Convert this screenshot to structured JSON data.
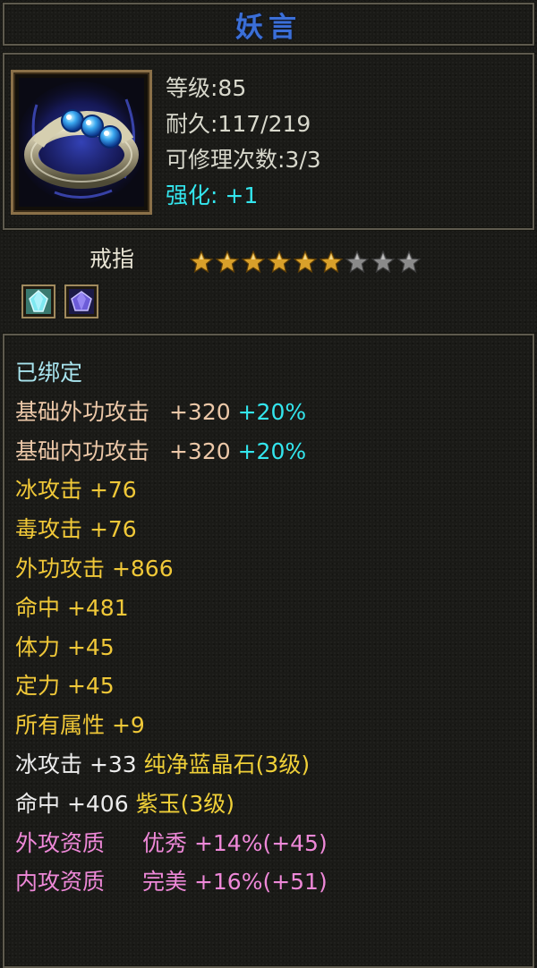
{
  "item": {
    "name": "妖言",
    "level": "等级:85",
    "durability": "耐久:117/219",
    "repair_count": "可修理次数:3/3",
    "enhance": "强化: +1",
    "type": "戒指",
    "stars_filled": 6,
    "stars_total": 9,
    "gem_icons": [
      "blue-crystal-gem-icon",
      "purple-jade-gem-icon"
    ]
  },
  "attributes": {
    "bound": "已绑定",
    "base_outer": {
      "label": "基础外功攻击",
      "value": "+320",
      "bonus": "+20%"
    },
    "base_inner": {
      "label": "基础内功攻击",
      "value": "+320",
      "bonus": "+20%"
    },
    "ice_attack": "冰攻击 +76",
    "poison_attack": "毒攻击 +76",
    "outer_attack": "外功攻击 +866",
    "hit": "命中 +481",
    "stamina": "体力 +45",
    "focus": "定力 +45",
    "all_attrs": "所有属性 +9",
    "gem1": {
      "stat": "冰攻击 +33",
      "name": "纯净蓝晶石(3级)"
    },
    "gem2": {
      "stat": "命中 +406",
      "name": "紫玉(3级)"
    },
    "quality1": {
      "label": "外攻资质",
      "grade": "优秀",
      "value": "+14%(+45)"
    },
    "quality2": {
      "label": "内攻资质",
      "grade": "完美",
      "value": "+16%(+51)"
    }
  },
  "colors": {
    "title": "#3b6fd8",
    "enhance": "#33e6ee",
    "star_gold": "#d9a02a",
    "star_gray": "#8a8a8a",
    "attribute_gold": "#f0c838",
    "quality_pink": "#ee88d8"
  }
}
